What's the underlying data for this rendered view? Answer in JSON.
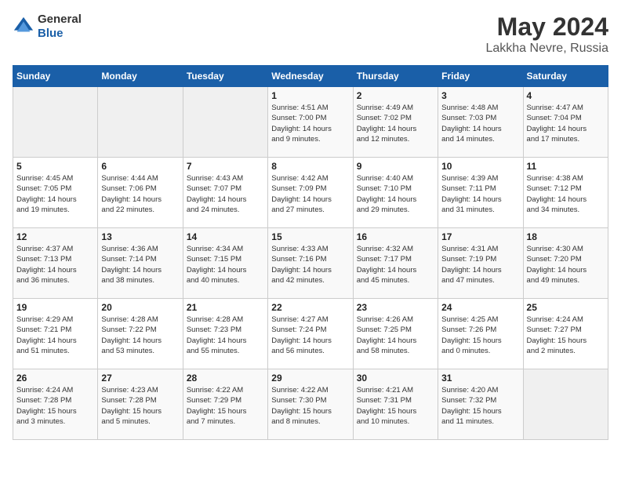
{
  "header": {
    "logo_general": "General",
    "logo_blue": "Blue",
    "month_title": "May 2024",
    "location": "Lakkha Nevre, Russia"
  },
  "weekdays": [
    "Sunday",
    "Monday",
    "Tuesday",
    "Wednesday",
    "Thursday",
    "Friday",
    "Saturday"
  ],
  "weeks": [
    [
      {
        "day": "",
        "info": ""
      },
      {
        "day": "",
        "info": ""
      },
      {
        "day": "",
        "info": ""
      },
      {
        "day": "1",
        "info": "Sunrise: 4:51 AM\nSunset: 7:00 PM\nDaylight: 14 hours\nand 9 minutes."
      },
      {
        "day": "2",
        "info": "Sunrise: 4:49 AM\nSunset: 7:02 PM\nDaylight: 14 hours\nand 12 minutes."
      },
      {
        "day": "3",
        "info": "Sunrise: 4:48 AM\nSunset: 7:03 PM\nDaylight: 14 hours\nand 14 minutes."
      },
      {
        "day": "4",
        "info": "Sunrise: 4:47 AM\nSunset: 7:04 PM\nDaylight: 14 hours\nand 17 minutes."
      }
    ],
    [
      {
        "day": "5",
        "info": "Sunrise: 4:45 AM\nSunset: 7:05 PM\nDaylight: 14 hours\nand 19 minutes."
      },
      {
        "day": "6",
        "info": "Sunrise: 4:44 AM\nSunset: 7:06 PM\nDaylight: 14 hours\nand 22 minutes."
      },
      {
        "day": "7",
        "info": "Sunrise: 4:43 AM\nSunset: 7:07 PM\nDaylight: 14 hours\nand 24 minutes."
      },
      {
        "day": "8",
        "info": "Sunrise: 4:42 AM\nSunset: 7:09 PM\nDaylight: 14 hours\nand 27 minutes."
      },
      {
        "day": "9",
        "info": "Sunrise: 4:40 AM\nSunset: 7:10 PM\nDaylight: 14 hours\nand 29 minutes."
      },
      {
        "day": "10",
        "info": "Sunrise: 4:39 AM\nSunset: 7:11 PM\nDaylight: 14 hours\nand 31 minutes."
      },
      {
        "day": "11",
        "info": "Sunrise: 4:38 AM\nSunset: 7:12 PM\nDaylight: 14 hours\nand 34 minutes."
      }
    ],
    [
      {
        "day": "12",
        "info": "Sunrise: 4:37 AM\nSunset: 7:13 PM\nDaylight: 14 hours\nand 36 minutes."
      },
      {
        "day": "13",
        "info": "Sunrise: 4:36 AM\nSunset: 7:14 PM\nDaylight: 14 hours\nand 38 minutes."
      },
      {
        "day": "14",
        "info": "Sunrise: 4:34 AM\nSunset: 7:15 PM\nDaylight: 14 hours\nand 40 minutes."
      },
      {
        "day": "15",
        "info": "Sunrise: 4:33 AM\nSunset: 7:16 PM\nDaylight: 14 hours\nand 42 minutes."
      },
      {
        "day": "16",
        "info": "Sunrise: 4:32 AM\nSunset: 7:17 PM\nDaylight: 14 hours\nand 45 minutes."
      },
      {
        "day": "17",
        "info": "Sunrise: 4:31 AM\nSunset: 7:19 PM\nDaylight: 14 hours\nand 47 minutes."
      },
      {
        "day": "18",
        "info": "Sunrise: 4:30 AM\nSunset: 7:20 PM\nDaylight: 14 hours\nand 49 minutes."
      }
    ],
    [
      {
        "day": "19",
        "info": "Sunrise: 4:29 AM\nSunset: 7:21 PM\nDaylight: 14 hours\nand 51 minutes."
      },
      {
        "day": "20",
        "info": "Sunrise: 4:28 AM\nSunset: 7:22 PM\nDaylight: 14 hours\nand 53 minutes."
      },
      {
        "day": "21",
        "info": "Sunrise: 4:28 AM\nSunset: 7:23 PM\nDaylight: 14 hours\nand 55 minutes."
      },
      {
        "day": "22",
        "info": "Sunrise: 4:27 AM\nSunset: 7:24 PM\nDaylight: 14 hours\nand 56 minutes."
      },
      {
        "day": "23",
        "info": "Sunrise: 4:26 AM\nSunset: 7:25 PM\nDaylight: 14 hours\nand 58 minutes."
      },
      {
        "day": "24",
        "info": "Sunrise: 4:25 AM\nSunset: 7:26 PM\nDaylight: 15 hours\nand 0 minutes."
      },
      {
        "day": "25",
        "info": "Sunrise: 4:24 AM\nSunset: 7:27 PM\nDaylight: 15 hours\nand 2 minutes."
      }
    ],
    [
      {
        "day": "26",
        "info": "Sunrise: 4:24 AM\nSunset: 7:28 PM\nDaylight: 15 hours\nand 3 minutes."
      },
      {
        "day": "27",
        "info": "Sunrise: 4:23 AM\nSunset: 7:28 PM\nDaylight: 15 hours\nand 5 minutes."
      },
      {
        "day": "28",
        "info": "Sunrise: 4:22 AM\nSunset: 7:29 PM\nDaylight: 15 hours\nand 7 minutes."
      },
      {
        "day": "29",
        "info": "Sunrise: 4:22 AM\nSunset: 7:30 PM\nDaylight: 15 hours\nand 8 minutes."
      },
      {
        "day": "30",
        "info": "Sunrise: 4:21 AM\nSunset: 7:31 PM\nDaylight: 15 hours\nand 10 minutes."
      },
      {
        "day": "31",
        "info": "Sunrise: 4:20 AM\nSunset: 7:32 PM\nDaylight: 15 hours\nand 11 minutes."
      },
      {
        "day": "",
        "info": ""
      }
    ]
  ]
}
